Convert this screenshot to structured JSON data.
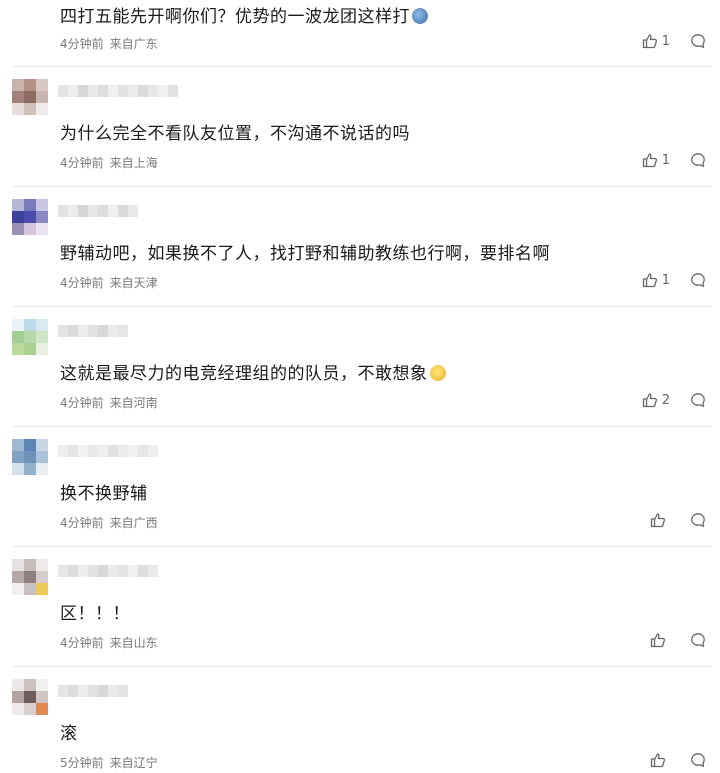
{
  "comments": [
    {
      "text": "四打五能先开啊你们？优势的一波龙团这样打",
      "time": "4分钟前",
      "location": "来自广东",
      "likes": "1"
    },
    {
      "text": "为什么完全不看队友位置，不沟通不说话的吗",
      "time": "4分钟前",
      "location": "来自上海",
      "likes": "1"
    },
    {
      "text": "野辅动吧，如果换不了人，找打野和辅助教练也行啊，要排名啊",
      "time": "4分钟前",
      "location": "来自天津",
      "likes": "1"
    },
    {
      "text": "这就是最尽力的电竞经理组的的队员，不敢想象",
      "time": "4分钟前",
      "location": "来自河南",
      "likes": "2"
    },
    {
      "text": "换不换野辅",
      "time": "4分钟前",
      "location": "来自广西",
      "likes": ""
    },
    {
      "text": "区！！！",
      "time": "4分钟前",
      "location": "来自山东",
      "likes": ""
    },
    {
      "text": "滚",
      "time": "5分钟前",
      "location": "来自辽宁",
      "likes": ""
    }
  ],
  "icons": {
    "like": "thumbs-up-icon",
    "reply": "comment-bubble-icon"
  },
  "colors": {
    "text": "#1a1a1a",
    "meta": "#7a7a7a",
    "separator": "#ececec"
  }
}
